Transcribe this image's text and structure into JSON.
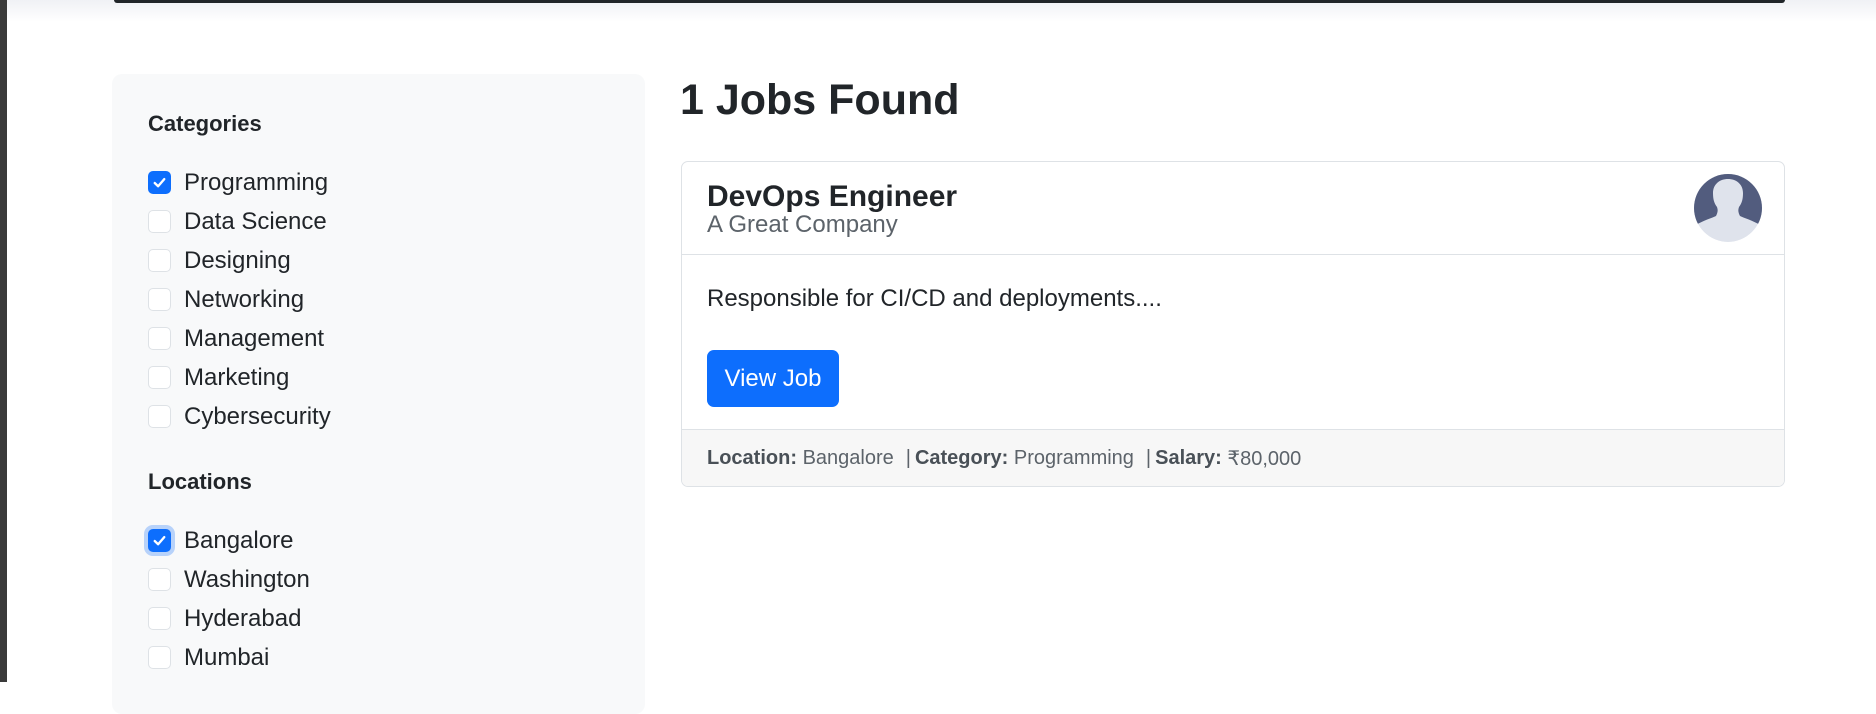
{
  "categories": {
    "title": "Categories",
    "items": [
      {
        "label": "Programming",
        "checked": true
      },
      {
        "label": "Data Science",
        "checked": false
      },
      {
        "label": "Designing",
        "checked": false
      },
      {
        "label": "Networking",
        "checked": false
      },
      {
        "label": "Management",
        "checked": false
      },
      {
        "label": "Marketing",
        "checked": false
      },
      {
        "label": "Cybersecurity",
        "checked": false
      }
    ]
  },
  "locations": {
    "title": "Locations",
    "items": [
      {
        "label": "Bangalore",
        "checked": true,
        "focused": true
      },
      {
        "label": "Washington",
        "checked": false
      },
      {
        "label": "Hyderabad",
        "checked": false
      },
      {
        "label": "Mumbai",
        "checked": false
      }
    ]
  },
  "results": {
    "title": "1 Jobs Found"
  },
  "job": {
    "title": "DevOps Engineer",
    "company": "A Great Company",
    "description": "Responsible for CI/CD and deployments....",
    "view_label": "View Job",
    "location_label": "Location:",
    "location": "Bangalore",
    "category_label": "Category:",
    "category": "Programming",
    "salary_label": "Salary:",
    "salary": "₹80,000",
    "separator": "|",
    "avatar_icon": "user-avatar-icon"
  },
  "colors": {
    "accent": "#0d6efd",
    "sidebar_bg": "#f8f9fa",
    "footer_bg": "#f7f7f7"
  }
}
